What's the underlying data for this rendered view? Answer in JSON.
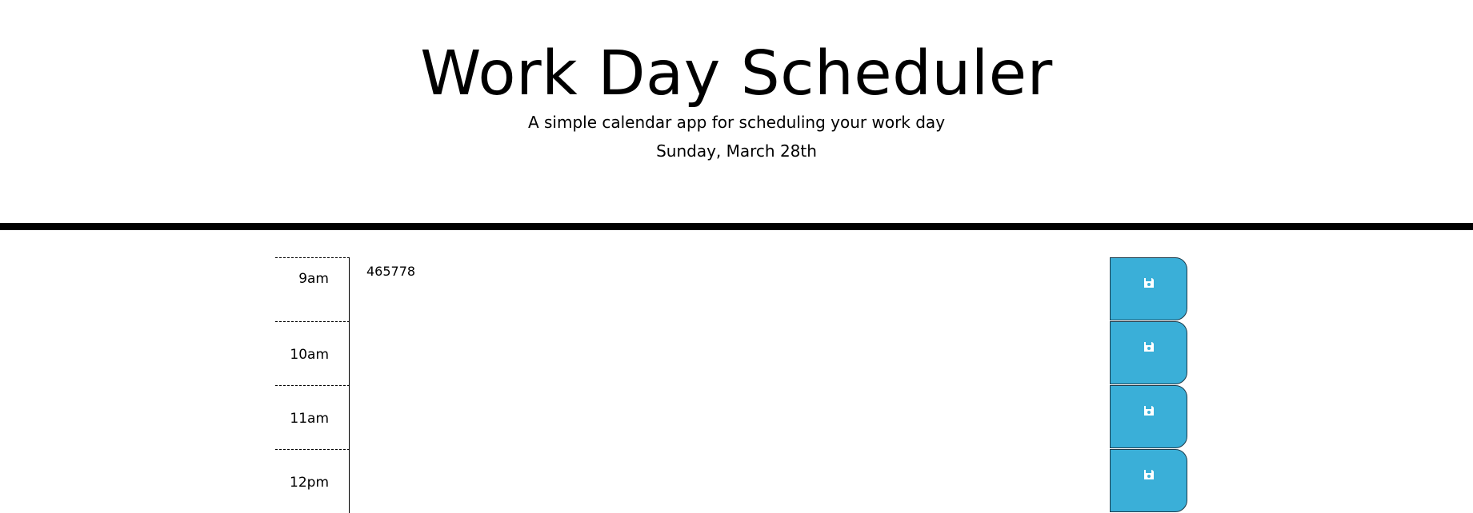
{
  "header": {
    "title": "Work Day Scheduler",
    "subtitle": "A simple calendar app for scheduling your work day",
    "current_day": "Sunday, March 28th"
  },
  "time_blocks": [
    {
      "hour": "9am",
      "text": "465778",
      "save_icon": "save-icon"
    },
    {
      "hour": "10am",
      "text": "",
      "save_icon": "save-icon"
    },
    {
      "hour": "11am",
      "text": "",
      "save_icon": "save-icon"
    },
    {
      "hour": "12pm",
      "text": "",
      "save_icon": "save-icon"
    }
  ],
  "colors": {
    "save_button": "#3aafd8",
    "header_rule": "#000000"
  }
}
